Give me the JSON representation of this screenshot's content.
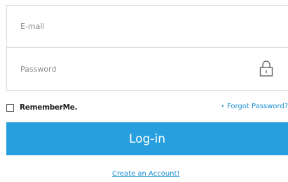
{
  "form": {
    "email_placeholder": "E-mail",
    "email_value": "",
    "password_placeholder": "Password",
    "password_value": ""
  },
  "icons": {
    "password": "lock-icon"
  },
  "options": {
    "remember_label": "RememberMe.",
    "remember_checked": false,
    "forgot_bullet": "•",
    "forgot_label": "Forgot Password?"
  },
  "actions": {
    "login_label": "Log-in",
    "create_account_label": "Create an Account!"
  },
  "colors": {
    "accent": "#279fde",
    "link": "#1e8fd6",
    "border": "#d9d9d9"
  }
}
